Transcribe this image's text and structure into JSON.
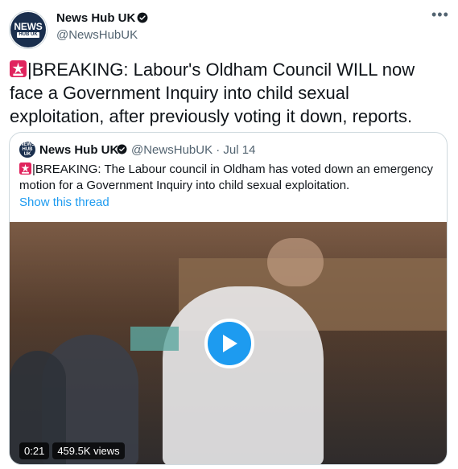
{
  "tweet": {
    "author": {
      "name": "News Hub UK",
      "handle": "@NewsHubUK",
      "avatar_text_top": "NEWS",
      "avatar_text_bottom": "HUB UK"
    },
    "text": "|BREAKING: Labour's Oldham Council WILL now face a Government Inquiry into child sexual exploitation, after previously voting it down, reports.",
    "emoji": "police-light-siren",
    "more_icon": "more-dots-icon"
  },
  "quote": {
    "author": {
      "name": "News Hub UK",
      "handle_and_date": "@NewsHubUK · Jul 14",
      "avatar_text": "NEWS HUB UK"
    },
    "text": "|BREAKING: The Labour council in Oldham has voted down an emergency motion for a  Government Inquiry into child sexual exploitation.",
    "show_thread": "Show this thread",
    "video": {
      "duration": "0:21",
      "views": "459.5K views",
      "play_icon": "play-icon"
    }
  },
  "colors": {
    "accent": "#1d9bf0",
    "text_primary": "#0f1419",
    "text_secondary": "#536471",
    "border": "#cfd9de",
    "avatar_bg": "#1a2f4e",
    "siren_red": "#e0245e"
  }
}
